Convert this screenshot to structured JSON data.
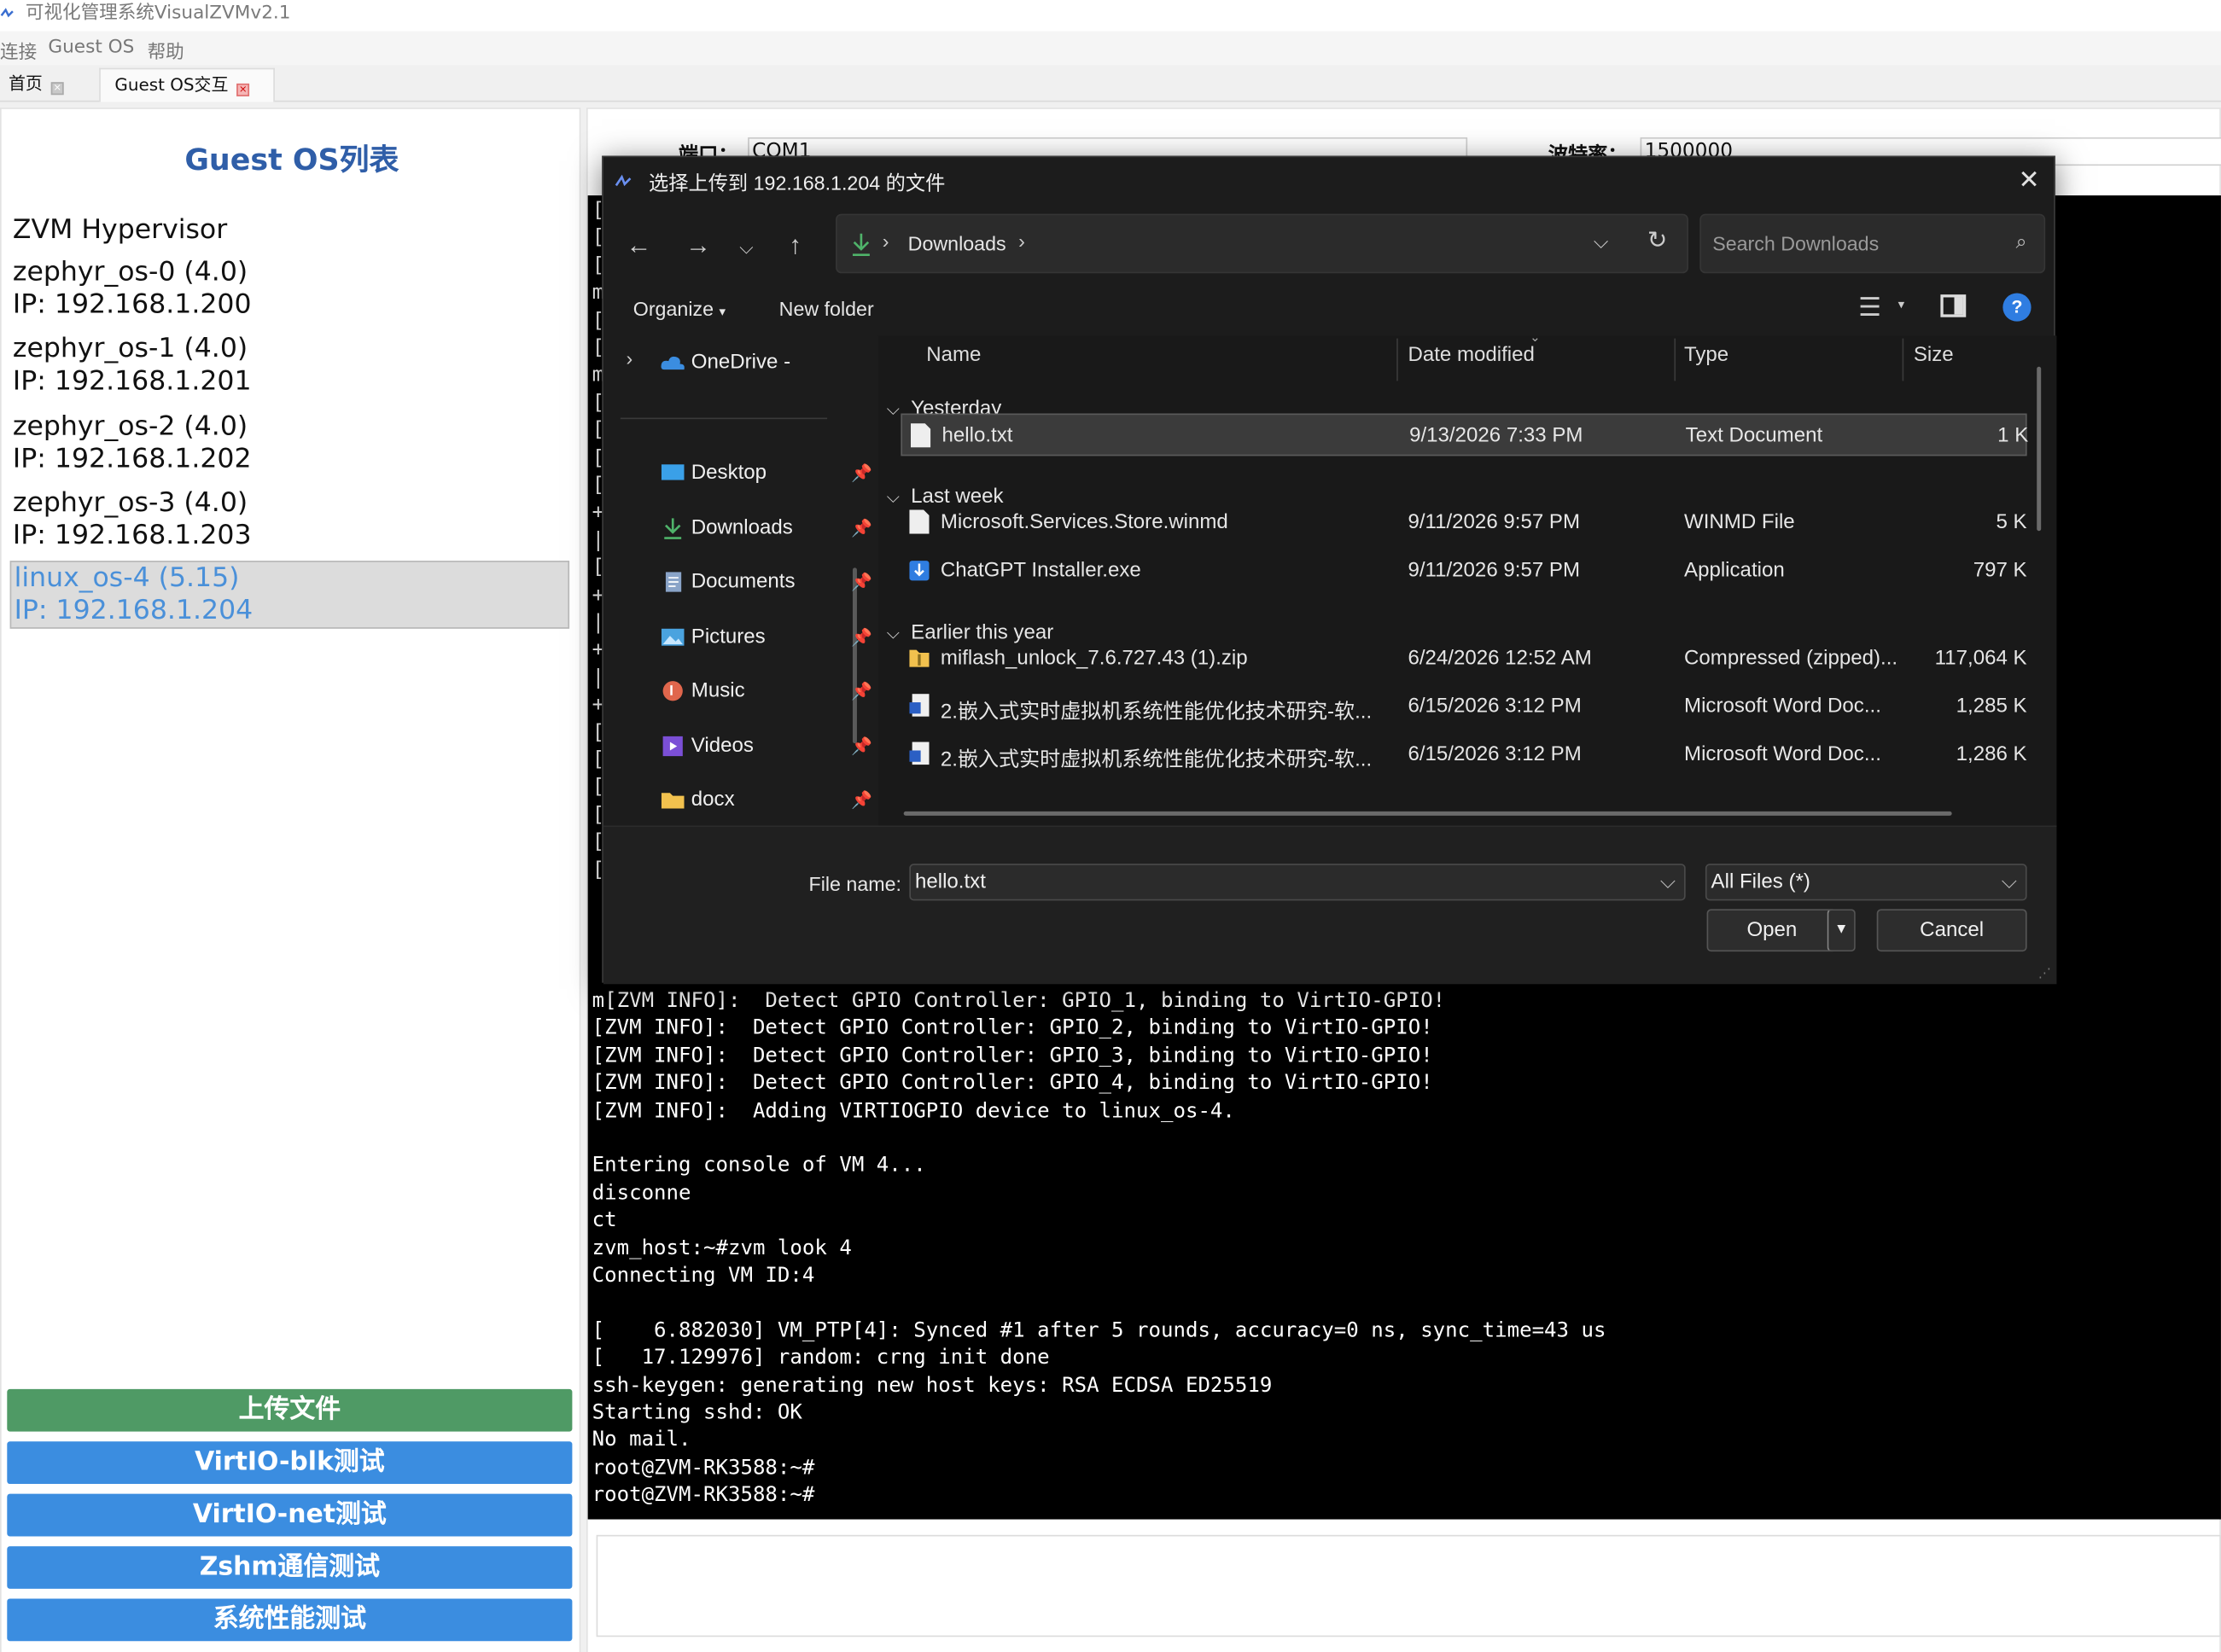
{
  "window": {
    "title": "可视化管理系统VisualZVMv2.1"
  },
  "menu": [
    "连接",
    "Guest OS",
    "帮助"
  ],
  "tabs": [
    {
      "label": "首页",
      "active": false
    },
    {
      "label": "Guest OS交互",
      "active": true
    }
  ],
  "left": {
    "title": "Guest OS列表",
    "hypervisor": "ZVM Hypervisor",
    "os_list": [
      {
        "name": "zephyr_os-0 (4.0)",
        "ip": "IP: 192.168.1.200",
        "selected": false
      },
      {
        "name": "zephyr_os-1 (4.0)",
        "ip": "IP: 192.168.1.201",
        "selected": false
      },
      {
        "name": "zephyr_os-2 (4.0)",
        "ip": "IP: 192.168.1.202",
        "selected": false
      },
      {
        "name": "zephyr_os-3 (4.0)",
        "ip": "IP: 192.168.1.203",
        "selected": false
      },
      {
        "name": "linux_os-4 (5.15)",
        "ip": "IP: 192.168.1.204",
        "selected": true
      }
    ],
    "buttons": [
      {
        "label": "上传文件",
        "color": "#4f9a65"
      },
      {
        "label": "VirtIO-blk测试",
        "color": "#3b8de0"
      },
      {
        "label": "VirtIO-net测试",
        "color": "#3b8de0"
      },
      {
        "label": "Zshm通信测试",
        "color": "#3b8de0"
      },
      {
        "label": "系统性能测试",
        "color": "#3b8de0"
      }
    ]
  },
  "serial": {
    "port_label": "端口：",
    "port_value": "COM1",
    "baud_label": "波特率：",
    "baud_value": "1500000"
  },
  "terminal": {
    "lines": [
      "m[ZVM INFO]:  Detect GPIO Controller: GPIO_1, binding to VirtIO-GPIO!",
      "[ZVM INFO]:  Detect GPIO Controller: GPIO_2, binding to VirtIO-GPIO!",
      "[ZVM INFO]:  Detect GPIO Controller: GPIO_3, binding to VirtIO-GPIO!",
      "[ZVM INFO]:  Detect GPIO Controller: GPIO_4, binding to VirtIO-GPIO!",
      "[ZVM INFO]:  Adding VIRTIOGPIO device to linux_os-4.",
      "",
      "Entering console of VM 4...",
      "disconne",
      "ct",
      "zvm_host:~#zvm look 4",
      "Connecting VM ID:4",
      "",
      "[    6.882030] VM_PTP[4]: Synced #1 after 5 rounds, accuracy=0 ns, sync_time=43 us",
      "[   17.129976] random: crng init done",
      "ssh-keygen: generating new host keys: RSA ECDSA ED25519",
      "Starting sshd: OK",
      "No mail.",
      "root@ZVM-RK3588:~#",
      "root@ZVM-RK3588:~#"
    ],
    "left_glyphs": [
      "[",
      "[",
      "[",
      "m",
      "[",
      "[",
      "m",
      "[",
      "[",
      "[",
      "[",
      "+",
      "|",
      "[",
      "+",
      "|",
      "+",
      "|",
      "+",
      "[",
      "[",
      "[",
      "[",
      "[",
      "["
    ]
  },
  "dialog": {
    "title": "选择上传到 192.168.1.204 的文件",
    "address": "Downloads",
    "search_placeholder": "Search Downloads",
    "organize": "Organize",
    "new_folder": "New folder",
    "nav": [
      {
        "label": "OneDrive - Perso",
        "icon": "cloud-icon"
      },
      {
        "label": "Desktop",
        "icon": "desktop-icon"
      },
      {
        "label": "Downloads",
        "icon": "download-icon"
      },
      {
        "label": "Documents",
        "icon": "document-icon"
      },
      {
        "label": "Pictures",
        "icon": "pictures-icon"
      },
      {
        "label": "Music",
        "icon": "music-icon"
      },
      {
        "label": "Videos",
        "icon": "videos-icon"
      },
      {
        "label": "docx",
        "icon": "folder-icon"
      }
    ],
    "columns": [
      "Name",
      "Date modified",
      "Type",
      "Size"
    ],
    "groups": [
      {
        "label": "Yesterday",
        "files": [
          {
            "name": "hello.txt",
            "date": "9/13/2026 7:33 PM",
            "type": "Text Document",
            "size": "1 K",
            "selected": true
          }
        ]
      },
      {
        "label": "Last week",
        "files": [
          {
            "name": "Microsoft.Services.Store.winmd",
            "date": "9/11/2026 9:57 PM",
            "type": "WINMD File",
            "size": "5 K"
          },
          {
            "name": "ChatGPT Installer.exe",
            "date": "9/11/2026 9:57 PM",
            "type": "Application",
            "size": "797 K"
          }
        ]
      },
      {
        "label": "Earlier this year",
        "files": [
          {
            "name": "miflash_unlock_7.6.727.43 (1).zip",
            "date": "6/24/2026 12:52 AM",
            "type": "Compressed (zipped)...",
            "size": "117,064 K"
          },
          {
            "name": "2.嵌入式实时虚拟机系统性能优化技术研究-软...",
            "date": "6/15/2026 3:12 PM",
            "type": "Microsoft Word Doc...",
            "size": "1,285 K"
          },
          {
            "name": "2.嵌入式实时虚拟机系统性能优化技术研究-软...",
            "date": "6/15/2026 3:12 PM",
            "type": "Microsoft Word Doc...",
            "size": "1,286 K"
          }
        ]
      }
    ],
    "file_name_label": "File name:",
    "file_name_value": "hello.txt",
    "filter": "All Files (*)",
    "open_label": "Open",
    "cancel_label": "Cancel"
  }
}
